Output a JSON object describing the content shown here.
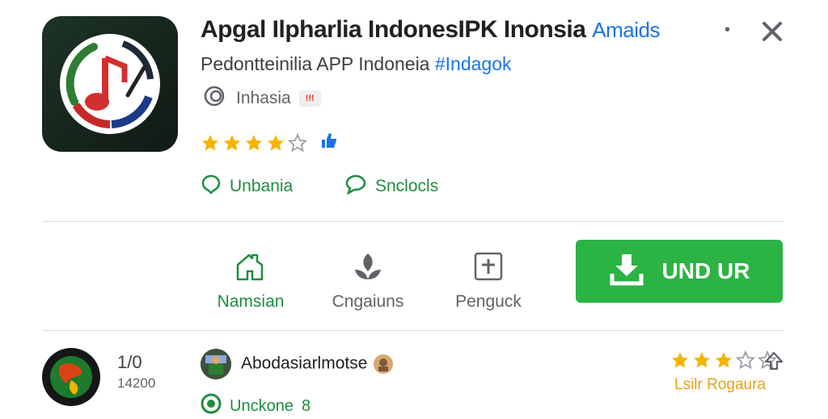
{
  "app": {
    "title": "Apgal Ilpharlia IndonesIPK Inonsia",
    "title_accent": "Amaids",
    "subtitle": "Pedontteinilia APP Indoneia",
    "subtitle_tag": "#Indagok",
    "developer": "Inhasia",
    "badge": "!!!",
    "rating": 4
  },
  "meta": {
    "left_label": "Unbania",
    "right_label": "Snclocls"
  },
  "actions": [
    {
      "label": "Namsian",
      "icon": "home-icon"
    },
    {
      "label": "Cngaiuns",
      "icon": "leaf-icon"
    },
    {
      "label": "Penguck",
      "icon": "plus-square-icon"
    }
  ],
  "install": {
    "label": "UND UR",
    "icon": "download-icon"
  },
  "review": {
    "score": "1/0",
    "count": "14200",
    "user": "Abodasiarlmotse",
    "status": "Unckone",
    "status_suffix": "8",
    "stars": 3,
    "tag": "Lsilr Rogaura"
  },
  "colors": {
    "accent": "#1a73e8",
    "install": "#2bb344",
    "star": "#f4b400",
    "green": "#1e8e3e"
  }
}
